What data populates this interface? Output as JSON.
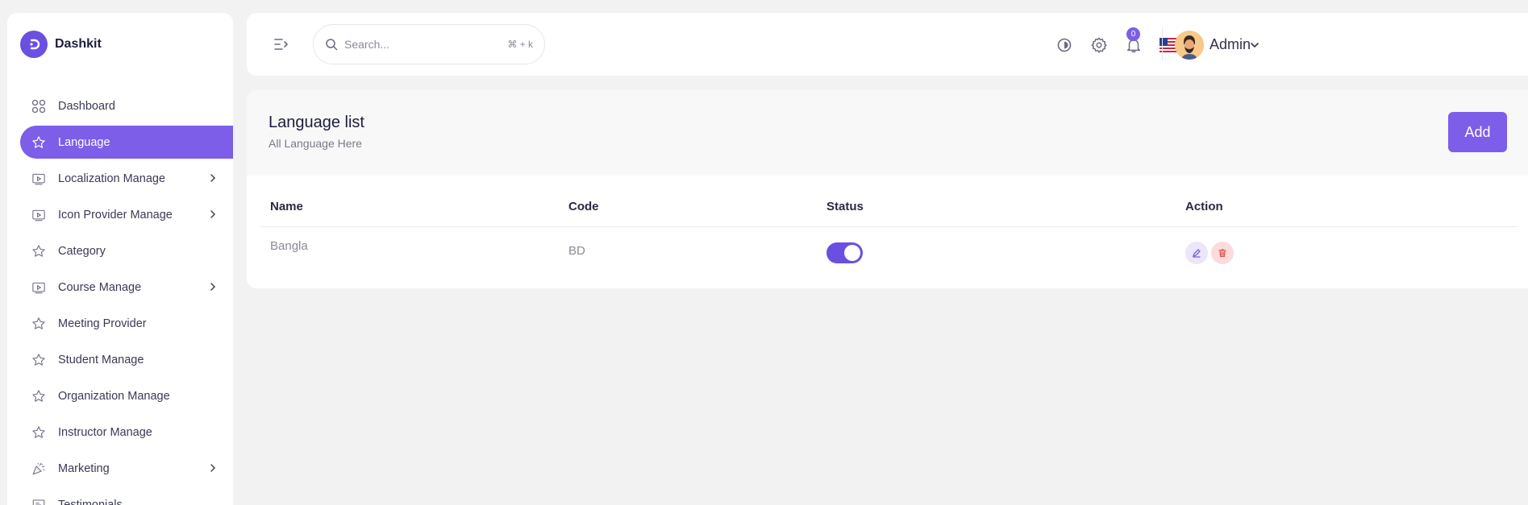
{
  "brand": {
    "name": "Dashkit"
  },
  "sidebar": {
    "items": [
      {
        "label": "Dashboard",
        "icon": "grid-icon",
        "active": false,
        "has_chevron": false
      },
      {
        "label": "Language",
        "icon": "star-icon",
        "active": true,
        "has_chevron": false
      },
      {
        "label": "Localization Manage",
        "icon": "video-icon",
        "active": false,
        "has_chevron": true
      },
      {
        "label": "Icon Provider Manage",
        "icon": "video-icon",
        "active": false,
        "has_chevron": true
      },
      {
        "label": "Category",
        "icon": "star-icon",
        "active": false,
        "has_chevron": false
      },
      {
        "label": "Course Manage",
        "icon": "video-icon",
        "active": false,
        "has_chevron": true
      },
      {
        "label": "Meeting Provider",
        "icon": "star-icon",
        "active": false,
        "has_chevron": false
      },
      {
        "label": "Student Manage",
        "icon": "star-icon",
        "active": false,
        "has_chevron": false
      },
      {
        "label": "Organization Manage",
        "icon": "star-icon",
        "active": false,
        "has_chevron": false
      },
      {
        "label": "Instructor Manage",
        "icon": "star-icon",
        "active": false,
        "has_chevron": false
      },
      {
        "label": "Marketing",
        "icon": "party-popper-icon",
        "active": false,
        "has_chevron": true
      },
      {
        "label": "Testimonials",
        "icon": "presentation-icon",
        "active": false,
        "has_chevron": false
      }
    ]
  },
  "topbar": {
    "search_placeholder": "Search...",
    "search_shortcut": "⌘ + k",
    "notification_count": "0",
    "user_name": "Admin"
  },
  "page": {
    "title": "Language list",
    "subtitle": "All Language Here",
    "add_label": "Add"
  },
  "table": {
    "headers": {
      "name": "Name",
      "code": "Code",
      "status": "Status",
      "action": "Action"
    },
    "rows": [
      {
        "name": "Bangla",
        "code": "BD",
        "status": true
      }
    ]
  },
  "colors": {
    "accent": "#7c5ee8",
    "accent_dark": "#6b4fe0",
    "danger_bg": "#fbdcdc",
    "danger": "#e05555"
  }
}
